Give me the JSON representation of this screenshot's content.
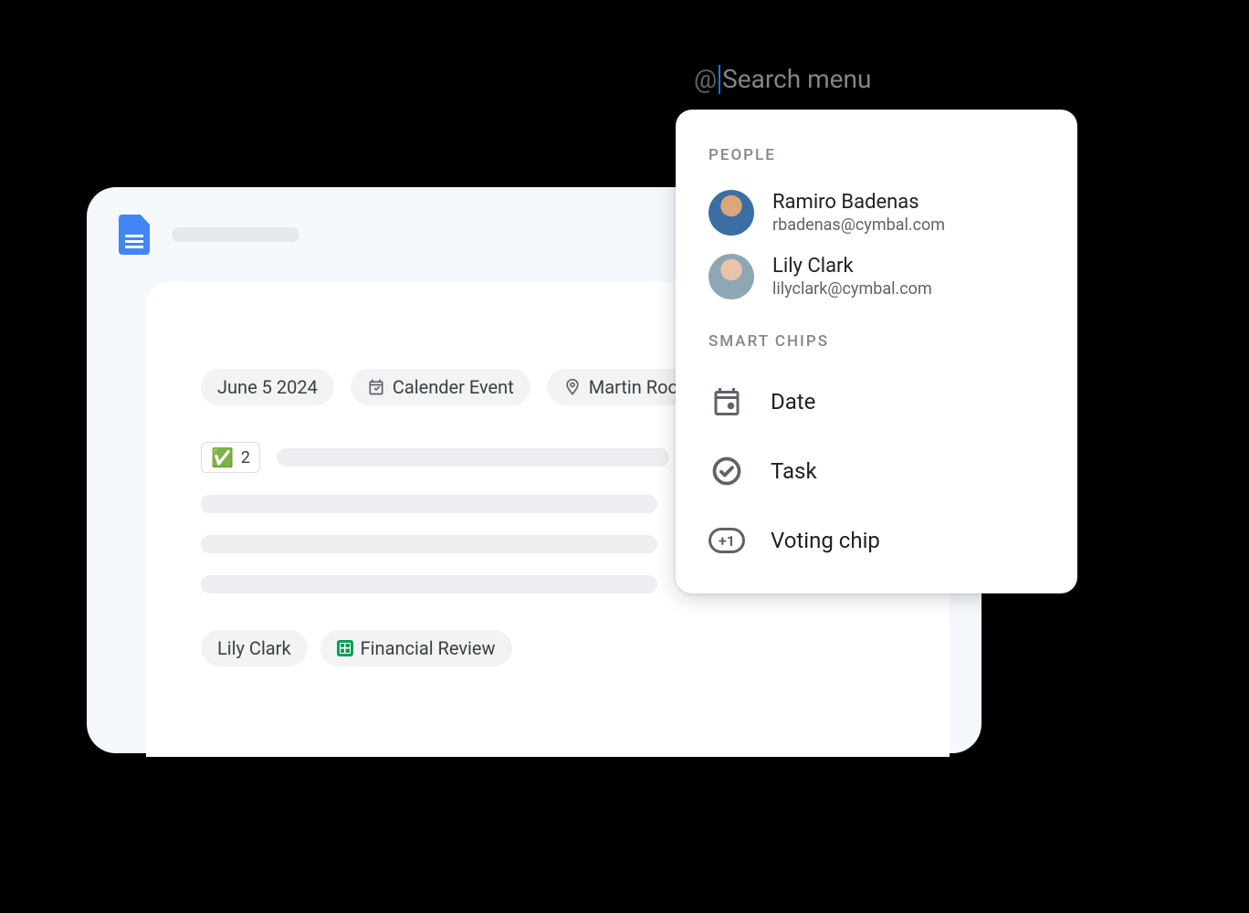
{
  "mention": {
    "at_symbol": "@",
    "placeholder": "Search menu"
  },
  "doc": {
    "chips": {
      "date": "June 5 2024",
      "event": "Calender Event",
      "location": "Martin Room"
    },
    "vote": {
      "emoji": "✅",
      "count": "2"
    },
    "bottom_chips": {
      "person": "Lily Clark",
      "file": "Financial Review"
    }
  },
  "popup": {
    "sections": {
      "people_header": "PEOPLE",
      "chips_header": "SMART CHIPS"
    },
    "people": [
      {
        "name": "Ramiro Badenas",
        "email": "rbadenas@cymbal.com"
      },
      {
        "name": "Lily Clark",
        "email": "lilyclark@cymbal.com"
      }
    ],
    "chips": {
      "date": "Date",
      "task": "Task",
      "voting": "Voting chip",
      "plus1": "+1"
    }
  }
}
